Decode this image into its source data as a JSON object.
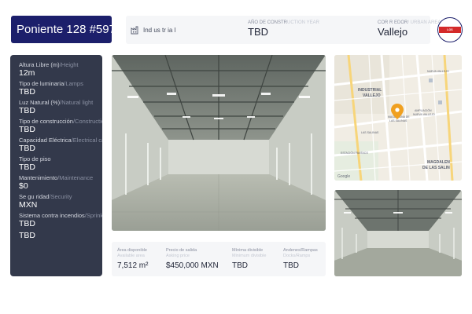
{
  "header": {
    "title": "Poniente 128 #597",
    "property_type": "Ind us tr ia l",
    "year_label": "AÑO DE CONSTR",
    "year_label_en": "UCTION YEAR",
    "year_value": "TBD",
    "corridor_label": "COR R EDOR",
    "corridor_label_en": "/ URBAN AREA",
    "corridor_value": "Vallejo",
    "logo_text": "LOS INMUEBLES"
  },
  "specs": [
    {
      "label": "Altura Libre (m)",
      "label_en": "/Height",
      "value": "12m"
    },
    {
      "label": "Tipo de luminaria",
      "label_en": "/Lamps",
      "value": "TBD"
    },
    {
      "label": "Luz Natural (%)",
      "label_en": "/Natural light",
      "value": "TBD"
    },
    {
      "label": "Tipo de construcción",
      "label_en": "/Construction",
      "value": "TBD"
    },
    {
      "label": "Capacidad Eléctrica",
      "label_en": "/Electrical capacity",
      "value": "TBD"
    },
    {
      "label": "Tipo de piso",
      "label_en": "",
      "value": "TBD"
    },
    {
      "label": "Mantenimiento",
      "label_en": "/Maintenance",
      "value": "$0"
    },
    {
      "label": "Se gu ridad",
      "label_en": "/Security",
      "value": "MXN"
    },
    {
      "label": "Sistema contra incendios",
      "label_en": "/Sprinkling System",
      "value": "TBD"
    },
    {
      "label": "",
      "label_en": "",
      "value": "TBD"
    }
  ],
  "stats": [
    {
      "label": "Área disponible",
      "label_en": "Available area",
      "value": "7,512 m²"
    },
    {
      "label": "Precio de salida",
      "label_en": "Asking price",
      "value": "$450,000 MXN"
    },
    {
      "label": "Mínima divisible",
      "label_en": "Minimum divisible",
      "value": "TBD"
    },
    {
      "label": "Andenes/Rampas",
      "label_en": "Docks/Ramps",
      "value": "TBD"
    }
  ],
  "map": {
    "labels": [
      "INDUSTRIAL",
      "VALLEJO",
      "AMPLIACIÓN",
      "NUEVA VALLEJO",
      "MAGDALENA DE",
      "LAS SALINAS",
      "LAS SALINAS",
      "NUEVA VALLEJO",
      "ESTACIÓN PANTACO",
      "MAGDALEN",
      "DE LAS SALIN"
    ],
    "attribution": "Google",
    "pin_color": "#f0a020"
  },
  "colors": {
    "title_bg": "#1c1f6b",
    "panel_bg": "#33394b",
    "accent_red": "#d42a2a"
  }
}
